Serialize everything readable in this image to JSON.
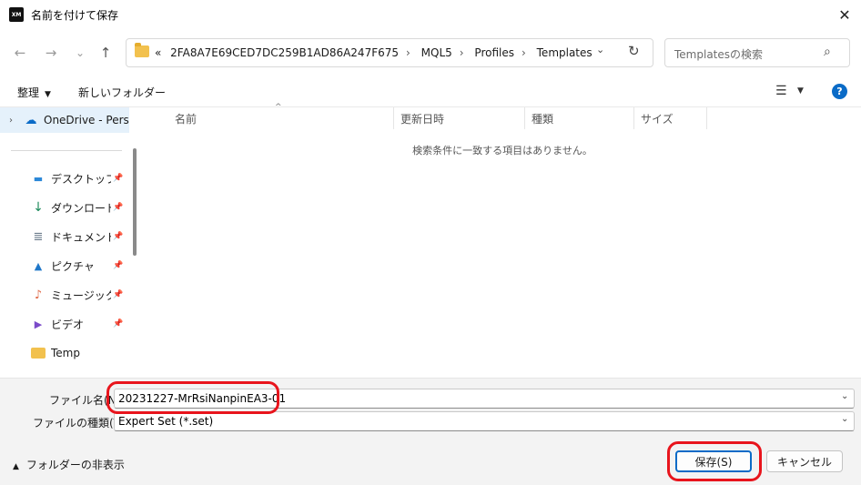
{
  "window": {
    "title": "名前を付けて保存",
    "app_icon_text": "XM",
    "close": "✕"
  },
  "nav": {
    "back": "←",
    "forward": "→",
    "recent": "⌄",
    "up": "↑"
  },
  "address": {
    "overflow": "«",
    "crumbs": [
      "2FA8A7E69CED7DC259B1AD86A247F675",
      "MQL5",
      "Profiles",
      "Templates"
    ],
    "separator": "›",
    "dropdown": "⌄",
    "refresh": "↻"
  },
  "search": {
    "placeholder": "Templatesの検索",
    "icon": "⌕"
  },
  "toolbar": {
    "organize": "整理",
    "organize_chev": "▼",
    "new_folder": "新しいフォルダー",
    "view_icon": "☰",
    "view_chev": "▼",
    "help": "?"
  },
  "sidebar": {
    "onedrive": {
      "label": "OneDrive - Personal",
      "expander": "›"
    },
    "items": [
      {
        "label": "デスクトップ",
        "icon": "desktop-icon",
        "glyph": "▬",
        "color": "#2b88d8"
      },
      {
        "label": "ダウンロード",
        "icon": "download-icon",
        "glyph": "↓",
        "color": "#1b8a5a"
      },
      {
        "label": "ドキュメント",
        "icon": "document-icon",
        "glyph": "≣",
        "color": "#6b7b8c"
      },
      {
        "label": "ピクチャ",
        "icon": "pictures-icon",
        "glyph": "▲",
        "color": "#1f77c9"
      },
      {
        "label": "ミュージック",
        "icon": "music-icon",
        "glyph": "♪",
        "color": "#e06c4b"
      },
      {
        "label": "ビデオ",
        "icon": "video-icon",
        "glyph": "▶",
        "color": "#7b4bc9"
      },
      {
        "label": "Temp",
        "icon": "folder-icon",
        "glyph": "",
        "color": "#f2c14e"
      }
    ],
    "pin": "📌"
  },
  "columns": {
    "name": "名前",
    "modified": "更新日時",
    "type": "種類",
    "size": "サイズ",
    "sort_caret": "^"
  },
  "content": {
    "empty_message": "検索条件に一致する項目はありません。"
  },
  "form": {
    "filename_label": "ファイル名(N):",
    "filename_value": "20231227-MrRsiNanpinEA3-01",
    "filetype_label": "ファイルの種類(T):",
    "filetype_value": "Expert Set (*.set)",
    "chev": "⌄"
  },
  "footer": {
    "hide_folders": "フォルダーの非表示",
    "hide_chev": "▲",
    "save": "保存(S)",
    "cancel": "キャンセル"
  },
  "colors": {
    "accent": "#0a6bc7",
    "annotation": "#e8141c",
    "selection": "#e5f1fb"
  }
}
